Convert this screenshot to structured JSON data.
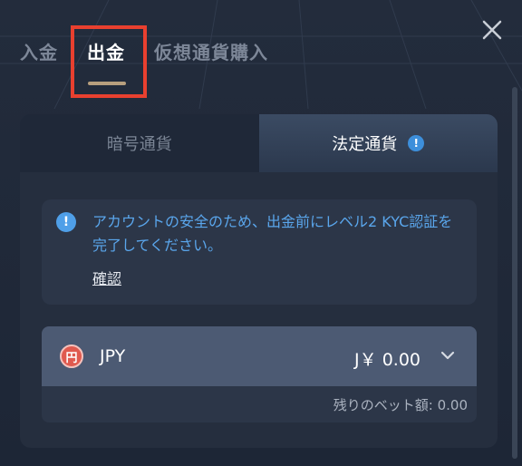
{
  "top_tabs": {
    "deposit": "入金",
    "withdraw": "出金",
    "buy_crypto": "仮想通貨購入"
  },
  "sub_tabs": {
    "crypto": "暗号通貨",
    "fiat": "法定通貨",
    "fiat_info_icon": "!"
  },
  "notice": {
    "icon": "!",
    "text": "アカウントの安全のため、出金前にレベル2 KYC認証を完了してください。",
    "link": "確認"
  },
  "currency": {
    "icon_glyph": "円",
    "code": "JPY",
    "amount": "J￥ 0.00",
    "remaining": "残りのベット額: 0.00"
  },
  "icons": {
    "close": "close-icon",
    "chevron": "chevron-down-icon",
    "yen": "yen-icon",
    "info": "info-icon"
  },
  "colors": {
    "accent_blue": "#4f9fe8",
    "tab_underline": "#b79f7e",
    "highlight_red": "#e9402f"
  }
}
